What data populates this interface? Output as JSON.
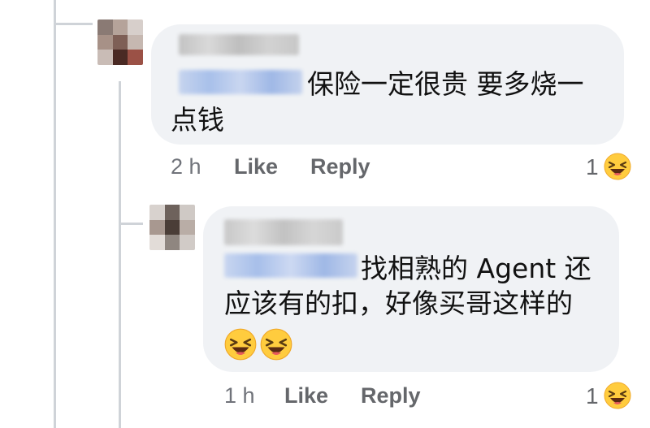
{
  "comments": [
    {
      "text_line1": "保险一定很贵 要多烧一",
      "text_line2": "点钱",
      "time": "2 h",
      "like_label": "Like",
      "reply_label": "Reply",
      "reaction_count": "1",
      "reaction_icon": "laughing-face-icon"
    },
    {
      "text_line1": "找相熟的 Agent 还",
      "text_line2": "应该有的扣，好像买哥这样的",
      "inline_emojis": [
        "laughing-face-icon",
        "laughing-face-icon"
      ],
      "time": "1 h",
      "like_label": "Like",
      "reply_label": "Reply",
      "reaction_count": "1",
      "reaction_icon": "laughing-face-icon"
    }
  ],
  "colors": {
    "bubble": "#f0f2f5",
    "meta_text": "#65676b",
    "thread_line": "#cfd3d8",
    "emoji_face": "#ffcc3e"
  }
}
